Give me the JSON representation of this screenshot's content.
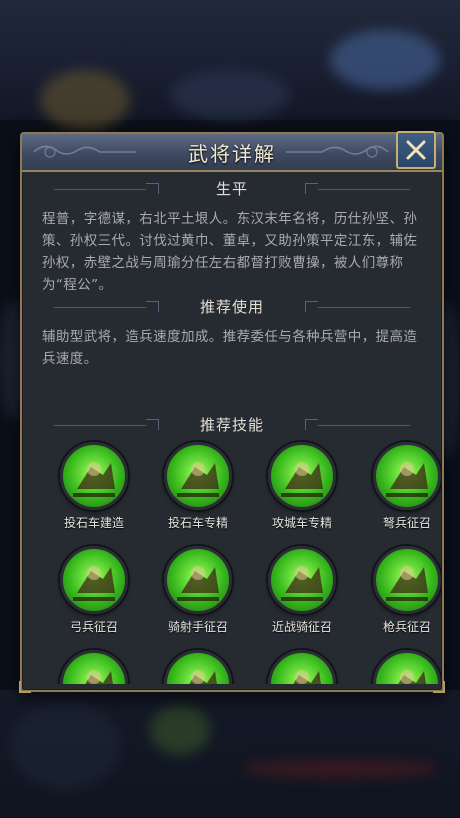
{
  "modal": {
    "title": "武将详解",
    "close_icon": "close-x-icon"
  },
  "sections": {
    "bio": {
      "heading": "生平",
      "text": "程普，字德谋，右北平土垠人。东汉末年名将，历仕孙坚、孙策、孙权三代。讨伐过黄巾、董卓，又助孙策平定江东，辅佐孙权，赤壁之战与周瑜分任左右都督打败曹操，被人们尊称为“程公”。"
    },
    "usage": {
      "heading": "推荐使用",
      "text": "辅助型武将，造兵速度加成。推荐委任与各种兵营中，提高造兵速度。"
    },
    "skills": {
      "heading": "推荐技能",
      "items": [
        {
          "label": "投石车建造",
          "icon": "catapult-build-icon"
        },
        {
          "label": "投石车专精",
          "icon": "catapult-mastery-icon"
        },
        {
          "label": "攻城车专精",
          "icon": "siege-ram-mastery-icon"
        },
        {
          "label": "弩兵征召",
          "icon": "crossbowman-recruit-icon"
        },
        {
          "label": "弓兵征召",
          "icon": "archer-recruit-icon"
        },
        {
          "label": "骑射手征召",
          "icon": "horse-archer-recruit-icon"
        },
        {
          "label": "近战骑征召",
          "icon": "melee-cavalry-recruit-icon"
        },
        {
          "label": "枪兵征召",
          "icon": "spearman-recruit-icon"
        },
        {
          "label": "",
          "icon": "skill-icon"
        },
        {
          "label": "",
          "icon": "skill-icon"
        },
        {
          "label": "",
          "icon": "skill-icon"
        },
        {
          "label": "",
          "icon": "skill-icon"
        }
      ]
    }
  },
  "colors": {
    "panel": "#262a31",
    "gold_border": "#8d7a52",
    "title_bar": "#3f4a62",
    "skill_green": "#37b81c",
    "text_muted": "#a9abb1"
  }
}
